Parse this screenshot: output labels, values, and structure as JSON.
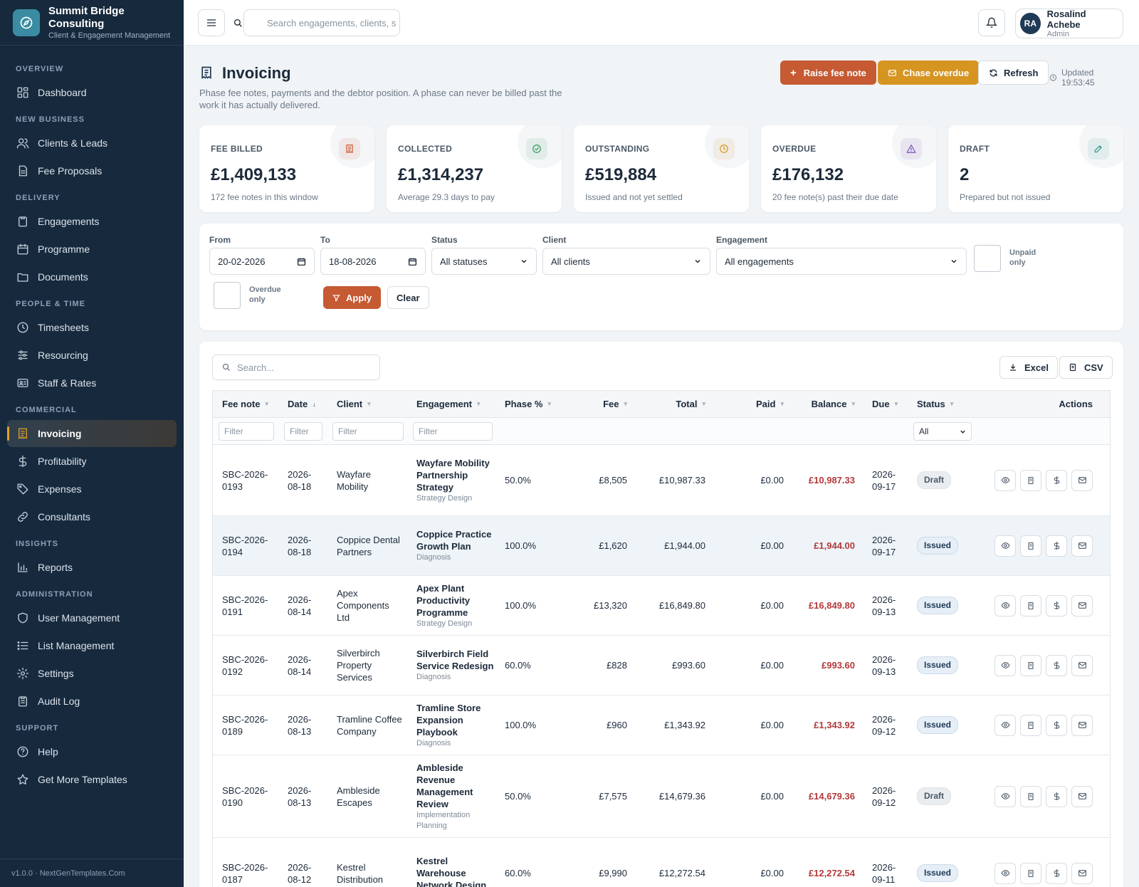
{
  "brand": {
    "name": "Summit Bridge Consulting",
    "subtitle": "Client & Engagement Management"
  },
  "sidebar": {
    "sections": [
      {
        "title": "OVERVIEW",
        "items": [
          {
            "label": "Dashboard",
            "icon": "dashboard-icon"
          }
        ]
      },
      {
        "title": "NEW BUSINESS",
        "items": [
          {
            "label": "Clients & Leads",
            "icon": "users-icon"
          },
          {
            "label": "Fee Proposals",
            "icon": "document-icon"
          }
        ]
      },
      {
        "title": "DELIVERY",
        "items": [
          {
            "label": "Engagements",
            "icon": "clipboard-icon"
          },
          {
            "label": "Programme",
            "icon": "calendar-icon"
          },
          {
            "label": "Documents",
            "icon": "folder-icon"
          }
        ]
      },
      {
        "title": "PEOPLE & TIME",
        "items": [
          {
            "label": "Timesheets",
            "icon": "clock-icon"
          },
          {
            "label": "Resourcing",
            "icon": "sliders-icon"
          },
          {
            "label": "Staff & Rates",
            "icon": "id-card-icon"
          }
        ]
      },
      {
        "title": "COMMERCIAL",
        "items": [
          {
            "label": "Invoicing",
            "icon": "receipt-icon",
            "active": true
          },
          {
            "label": "Profitability",
            "icon": "dollar-icon"
          },
          {
            "label": "Expenses",
            "icon": "tag-icon"
          },
          {
            "label": "Consultants",
            "icon": "link-icon"
          }
        ]
      },
      {
        "title": "INSIGHTS",
        "items": [
          {
            "label": "Reports",
            "icon": "bar-chart-icon"
          }
        ]
      },
      {
        "title": "ADMINISTRATION",
        "items": [
          {
            "label": "User Management",
            "icon": "shield-icon"
          },
          {
            "label": "List Management",
            "icon": "list-icon"
          },
          {
            "label": "Settings",
            "icon": "gear-icon"
          },
          {
            "label": "Audit Log",
            "icon": "clipboard-list-icon"
          }
        ]
      },
      {
        "title": "SUPPORT",
        "items": [
          {
            "label": "Help",
            "icon": "help-icon"
          },
          {
            "label": "Get More Templates",
            "icon": "star-icon"
          }
        ]
      }
    ],
    "version": "v1.0.0 · NextGenTemplates.Com"
  },
  "topbar": {
    "search_placeholder": "Search engagements, clients, s",
    "user": {
      "initials": "RA",
      "name": "Rosalind Achebe",
      "role": "Admin"
    }
  },
  "page": {
    "title": "Invoicing",
    "description": "Phase fee notes, payments and the debtor position. A phase can never be billed past the work it has actually delivered.",
    "actions": {
      "raise": "Raise fee note",
      "chase": "Chase overdue",
      "refresh": "Refresh"
    },
    "updated": "Updated 19:53:45"
  },
  "kpis": [
    {
      "label": "FEE BILLED",
      "value": "£1,409,133",
      "sub": "172 fee notes in this window",
      "icon": "receipt-icon",
      "color": "#c55a33"
    },
    {
      "label": "COLLECTED",
      "value": "£1,314,237",
      "sub": "Average 29.3 days to pay",
      "icon": "check-circle-icon",
      "color": "#2e9a5c"
    },
    {
      "label": "OUTSTANDING",
      "value": "£519,884",
      "sub": "Issued and not yet settled",
      "icon": "clock-icon",
      "color": "#d69421"
    },
    {
      "label": "OVERDUE",
      "value": "£176,132",
      "sub": "20 fee note(s) past their due date",
      "icon": "warning-icon",
      "color": "#7a4fb8"
    },
    {
      "label": "DRAFT",
      "value": "2",
      "sub": "Prepared but not issued",
      "icon": "edit-icon",
      "color": "#2a9a8a"
    }
  ],
  "filters": {
    "from_label": "From",
    "from_value": "20-02-2026",
    "to_label": "To",
    "to_value": "18-08-2026",
    "status_label": "Status",
    "status_value": "All statuses",
    "client_label": "Client",
    "client_value": "All clients",
    "engagement_label": "Engagement",
    "engagement_value": "All engagements",
    "unpaid_label": "Unpaid only",
    "overdue_label": "Overdue only",
    "apply": "Apply",
    "clear": "Clear"
  },
  "table": {
    "search_placeholder": "Search...",
    "export_excel": "Excel",
    "export_csv": "CSV",
    "columns": [
      "Fee note",
      "Date",
      "Client",
      "Engagement",
      "Phase %",
      "Fee",
      "Total",
      "Paid",
      "Balance",
      "Due",
      "Status",
      "Actions"
    ],
    "filter_placeholder": "Filter",
    "status_filter": "All",
    "rows": [
      {
        "fee_note": "SBC-2026-0193",
        "date": "2026-08-18",
        "client": "Wayfare Mobility",
        "engagement": "Wayfare Mobility Partnership Strategy",
        "eng_type": "Strategy Design",
        "phase": "50.0%",
        "fee": "£8,505",
        "total": "£10,987.33",
        "paid": "£0.00",
        "balance": "£10,987.33",
        "due": "2026-09-17",
        "status": "Draft"
      },
      {
        "fee_note": "SBC-2026-0194",
        "date": "2026-08-18",
        "client": "Coppice Dental Partners",
        "engagement": "Coppice Practice Growth Plan",
        "eng_type": "Diagnosis",
        "phase": "100.0%",
        "fee": "£1,620",
        "total": "£1,944.00",
        "paid": "£0.00",
        "balance": "£1,944.00",
        "due": "2026-09-17",
        "status": "Issued"
      },
      {
        "fee_note": "SBC-2026-0191",
        "date": "2026-08-14",
        "client": "Apex Components Ltd",
        "engagement": "Apex Plant Productivity Programme",
        "eng_type": "Strategy Design",
        "phase": "100.0%",
        "fee": "£13,320",
        "total": "£16,849.80",
        "paid": "£0.00",
        "balance": "£16,849.80",
        "due": "2026-09-13",
        "status": "Issued"
      },
      {
        "fee_note": "SBC-2026-0192",
        "date": "2026-08-14",
        "client": "Silverbirch Property Services",
        "engagement": "Silverbirch Field Service Redesign",
        "eng_type": "Diagnosis",
        "phase": "60.0%",
        "fee": "£828",
        "total": "£993.60",
        "paid": "£0.00",
        "balance": "£993.60",
        "due": "2026-09-13",
        "status": "Issued"
      },
      {
        "fee_note": "SBC-2026-0189",
        "date": "2026-08-13",
        "client": "Tramline Coffee Company",
        "engagement": "Tramline Store Expansion Playbook",
        "eng_type": "Diagnosis",
        "phase": "100.0%",
        "fee": "£960",
        "total": "£1,343.92",
        "paid": "£0.00",
        "balance": "£1,343.92",
        "due": "2026-09-12",
        "status": "Issued"
      },
      {
        "fee_note": "SBC-2026-0190",
        "date": "2026-08-13",
        "client": "Ambleside Escapes",
        "engagement": "Ambleside Revenue Management Review",
        "eng_type": "Implementation Planning",
        "phase": "50.0%",
        "fee": "£7,575",
        "total": "£14,679.36",
        "paid": "£0.00",
        "balance": "£14,679.36",
        "due": "2026-09-12",
        "status": "Draft"
      },
      {
        "fee_note": "SBC-2026-0187",
        "date": "2026-08-12",
        "client": "Kestrel Distribution",
        "engagement": "Kestrel Warehouse Network Design",
        "eng_type": "",
        "phase": "60.0%",
        "fee": "£9,990",
        "total": "£12,272.54",
        "paid": "£0.00",
        "balance": "£12,272.54",
        "due": "2026-09-11",
        "status": "Issued"
      }
    ]
  }
}
